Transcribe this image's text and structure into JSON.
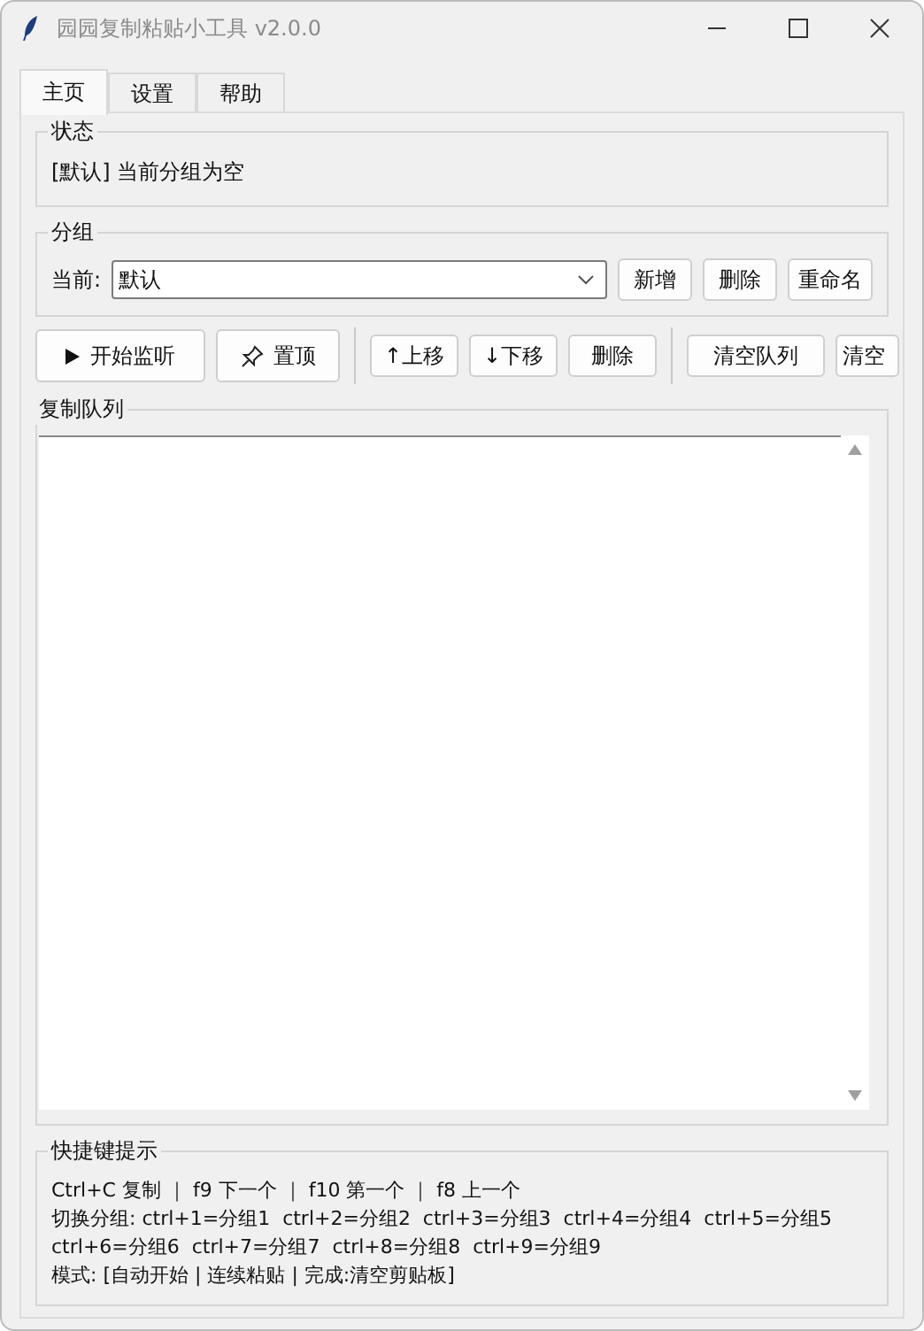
{
  "window": {
    "title": "园园复制粘贴小工具 v2.0.0"
  },
  "tabs": [
    {
      "label": "主页",
      "selected": true
    },
    {
      "label": "设置",
      "selected": false
    },
    {
      "label": "帮助",
      "selected": false
    }
  ],
  "status": {
    "title": "状态",
    "text": "[默认] 当前分组为空"
  },
  "group": {
    "title": "分组",
    "label": "当前:",
    "value": "默认",
    "buttons": [
      "新增",
      "删除",
      "重命名"
    ]
  },
  "toolbar": [
    [
      {
        "label": "开始监听",
        "kind": "play"
      },
      {
        "label": "置顶",
        "kind": "pin"
      }
    ],
    [
      {
        "label": "↑上移",
        "kind": "text"
      },
      {
        "label": "↓下移",
        "kind": "text"
      },
      {
        "label": "删除",
        "kind": "text"
      }
    ],
    [
      {
        "label": "清空队列",
        "kind": "text"
      },
      {
        "label": "清空",
        "kind": "text"
      }
    ]
  ],
  "queue": {
    "title": "复制队列"
  },
  "hints": {
    "title": "快捷键提示",
    "lines": [
      "Ctrl+C 复制 ｜ f9 下一个 ｜ f10 第一个 ｜ f8 上一个",
      "切换分组: ctrl+1=分组1  ctrl+2=分组2  ctrl+3=分组3  ctrl+4=分组4  ctrl+5=分组5",
      "ctrl+6=分组6  ctrl+7=分组7  ctrl+8=分组8  ctrl+9=分组9",
      "模式: [自动开始 | 连续粘贴 | 完成:清空剪贴板]"
    ]
  }
}
